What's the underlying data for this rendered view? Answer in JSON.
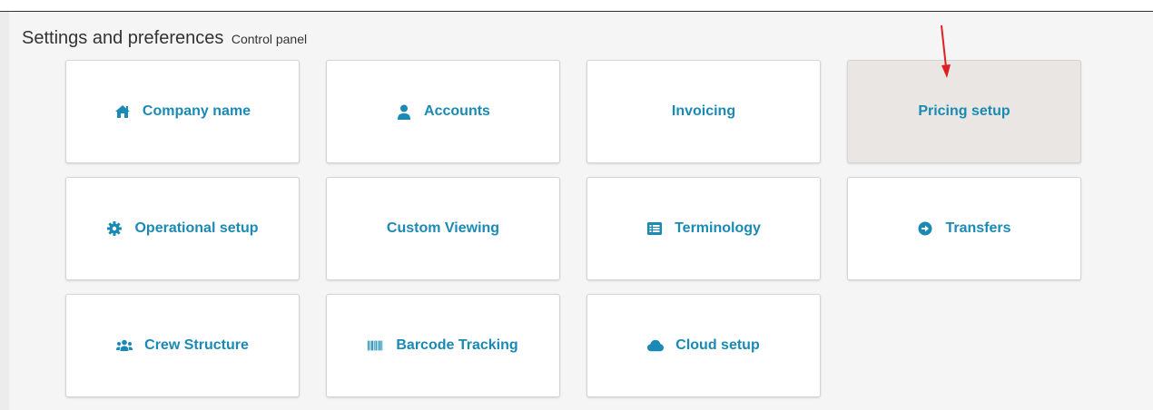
{
  "header": {
    "title": "Settings and preferences",
    "subtitle": "Control panel"
  },
  "tiles": [
    {
      "label": "Company name",
      "icon": "home-icon",
      "active": false
    },
    {
      "label": "Accounts",
      "icon": "user-icon",
      "active": false
    },
    {
      "label": "Invoicing",
      "icon": "",
      "active": false
    },
    {
      "label": "Pricing setup",
      "icon": "",
      "active": true
    },
    {
      "label": "Operational setup",
      "icon": "gear-icon",
      "active": false
    },
    {
      "label": "Custom Viewing",
      "icon": "",
      "active": false
    },
    {
      "label": "Terminology",
      "icon": "list-icon",
      "active": false
    },
    {
      "label": "Transfers",
      "icon": "arrow-circle-right-icon",
      "active": false
    },
    {
      "label": "Crew Structure",
      "icon": "users-icon",
      "active": false
    },
    {
      "label": "Barcode Tracking",
      "icon": "barcode-icon",
      "active": false
    },
    {
      "label": "Cloud setup",
      "icon": "cloud-icon",
      "active": false
    }
  ],
  "colors": {
    "accent": "#1a8ab4",
    "active_tile_bg": "#e9e6e3",
    "annotation_arrow": "#e02020"
  }
}
